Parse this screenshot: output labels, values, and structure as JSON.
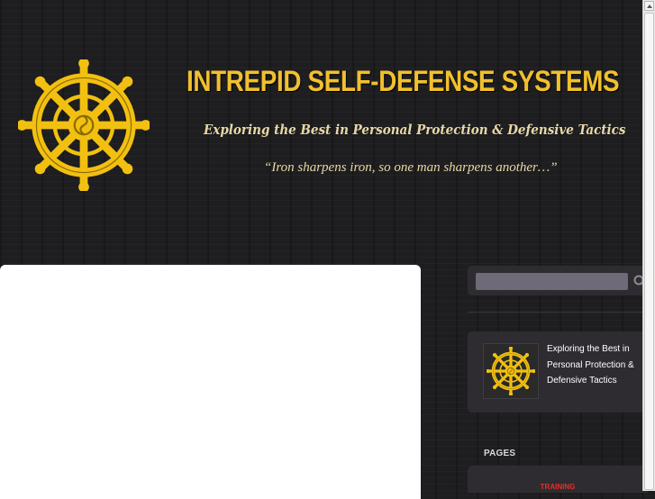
{
  "header": {
    "title": "INTREPID SELF-DEFENSE SYSTEMS",
    "tagline": "Exploring the Best in Personal Protection & Defensive Tactics",
    "quote": "“Iron sharpens iron, so one man sharpens another…”",
    "logo_icon": "dharma-wheel-icon"
  },
  "sidebar": {
    "search": {
      "placeholder": "",
      "icon": "search-icon"
    },
    "about": {
      "text": "Exploring the Best in Personal Protection & Defensive Tactics"
    },
    "pages": {
      "heading": "PAGES",
      "items": [
        {
          "label": "TRAINING"
        }
      ]
    }
  },
  "colors": {
    "gold": "#f1c02e",
    "background": "#1e1d1f",
    "panel": "#2e2c30",
    "link_red": "#e0312a"
  }
}
